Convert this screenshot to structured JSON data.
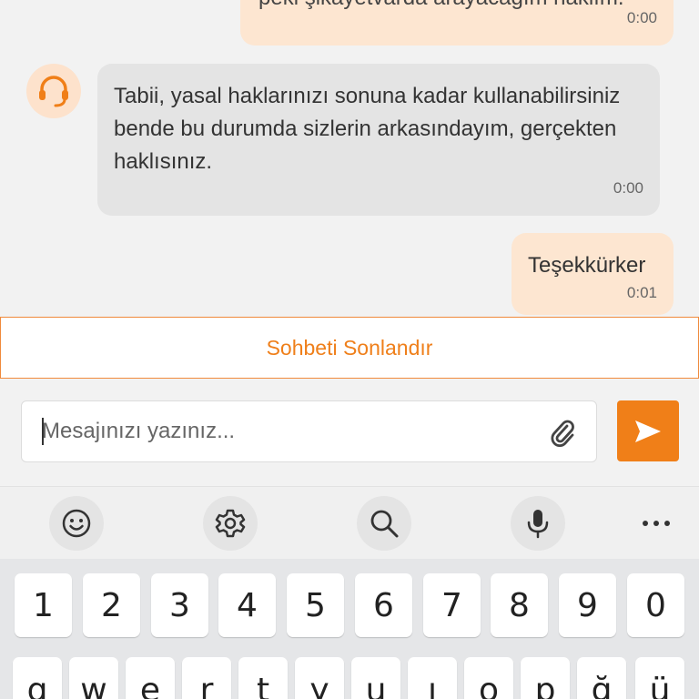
{
  "messages": [
    {
      "direction": "outgoing",
      "text": "peki şikayetvarda arayacağım haklım.",
      "time": "0:00"
    },
    {
      "direction": "incoming",
      "text": "Tabii, yasal haklarınızı sonuna kadar kullanabilirsiniz bende bu durumda sizlerin arkasındayım, gerçekten haklısınız.",
      "time": "0:00",
      "avatar_icon": "headset-icon"
    },
    {
      "direction": "outgoing",
      "text": "Teşekkürker",
      "time": "0:01"
    }
  ],
  "end_chat": {
    "label": "Sohbeti Sonlandır"
  },
  "composer": {
    "placeholder": "Mesajınızı yazınız...",
    "attach_icon": "paperclip-icon",
    "send_icon": "send-icon"
  },
  "keyboard": {
    "toolbar": [
      "emoji-icon",
      "settings-icon",
      "search-icon",
      "microphone-icon",
      "more-icon"
    ],
    "number_row": [
      "1",
      "2",
      "3",
      "4",
      "5",
      "6",
      "7",
      "8",
      "9",
      "0"
    ],
    "letter_row": [
      "q",
      "w",
      "e",
      "r",
      "t",
      "y",
      "u",
      "ı",
      "o",
      "p",
      "ğ",
      "ü"
    ]
  },
  "colors": {
    "accent": "#F07F18",
    "outgoing_bubble": "#FDE6D1",
    "incoming_bubble": "#E4E4E4",
    "avatar_bg": "#FDE2CC"
  }
}
